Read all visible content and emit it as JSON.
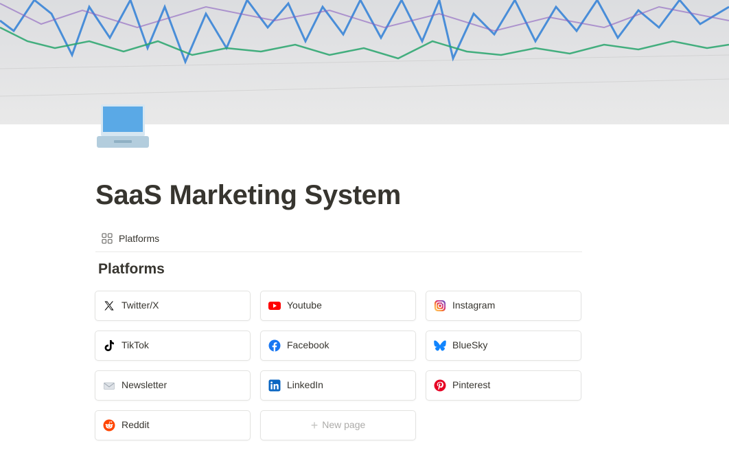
{
  "page": {
    "title": "SaaS Marketing System",
    "cover_description_color": "#e0e0e0"
  },
  "view_tabs": [
    {
      "label": "Platforms",
      "icon": "gallery-grid-icon"
    }
  ],
  "section": {
    "heading": "Platforms"
  },
  "cards": [
    {
      "label": "Twitter/X",
      "icon": "x-twitter-icon"
    },
    {
      "label": "Youtube",
      "icon": "youtube-icon"
    },
    {
      "label": "Instagram",
      "icon": "instagram-icon"
    },
    {
      "label": "TikTok",
      "icon": "tiktok-icon"
    },
    {
      "label": "Facebook",
      "icon": "facebook-icon"
    },
    {
      "label": "BlueSky",
      "icon": "bluesky-icon"
    },
    {
      "label": "Newsletter",
      "icon": "envelope-icon"
    },
    {
      "label": "LinkedIn",
      "icon": "linkedin-icon"
    },
    {
      "label": "Pinterest",
      "icon": "pinterest-icon"
    },
    {
      "label": "Reddit",
      "icon": "reddit-icon"
    }
  ],
  "new_page": {
    "label": "New page"
  },
  "colors": {
    "youtube": "#ff0000",
    "facebook": "#1877f2",
    "bluesky": "#1185fe",
    "linkedin": "#0a66c2",
    "pinterest": "#e60023",
    "reddit": "#ff4500",
    "laptop": "#5aa9e6"
  }
}
